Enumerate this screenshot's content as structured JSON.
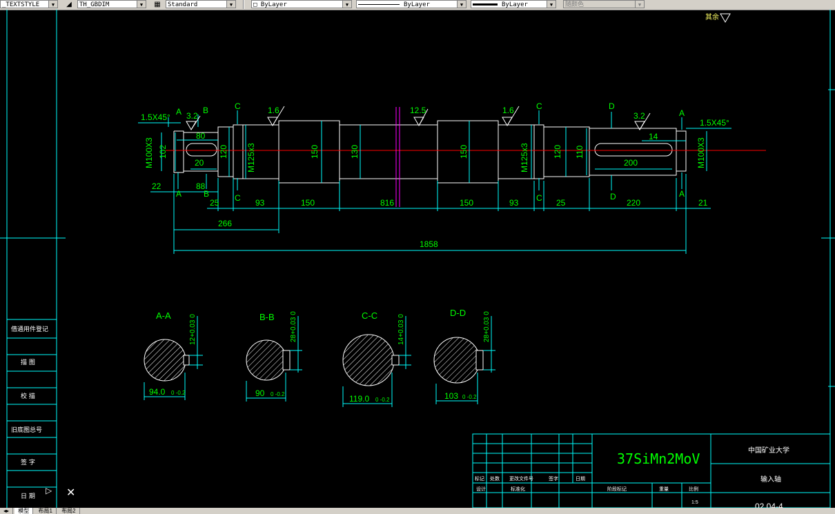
{
  "toolbar": {
    "text_style": "_TEXTSTYLE",
    "dim_style": "TH_GBDIM",
    "table_style": "Standard",
    "layer": "ByLayer",
    "linetype": "ByLayer",
    "lineweight": "ByLayer",
    "plot_style": "随颜色"
  },
  "tabs": [
    "模型",
    "布局1",
    "布局2"
  ],
  "drawing": {
    "roughness_other": "其余",
    "roughness": [
      "1.6",
      "3.2",
      "12.5",
      "1.6",
      "3.2"
    ],
    "chamfer_left": "1.5X45°",
    "chamfer_right": "1.5X45°",
    "section_marks": [
      "A",
      "B",
      "C",
      "C",
      "D",
      "A",
      "A",
      "B",
      "C",
      "C",
      "D",
      "A"
    ],
    "diameters": [
      "M100X3",
      "102",
      "120",
      "M125x3",
      "150",
      "130",
      "150",
      "M125x3",
      "120",
      "110",
      "M100X3"
    ],
    "keyway_left": [
      "80",
      "20",
      "88"
    ],
    "keyway_right": [
      "14",
      "200"
    ],
    "dims_bottom": [
      "22",
      "25",
      "93",
      "150",
      "816",
      "150",
      "93",
      "25",
      "220",
      "21"
    ],
    "dim_266": "266",
    "dim_total": "1858",
    "sections": [
      {
        "title": "A-A",
        "tol": "12+0.03 0",
        "dia": "94.0",
        "dia_tol": "0 -0.2"
      },
      {
        "title": "B-B",
        "tol": "28+0.03 0",
        "dia": "90",
        "dia_tol": "0 -0.2"
      },
      {
        "title": "C-C",
        "tol": "14+0.03 0",
        "dia": "119.0",
        "dia_tol": "0 -0.2"
      },
      {
        "title": "D-D",
        "tol": "28+0.03 0",
        "dia": "103",
        "dia_tol": "0 -0.2"
      }
    ]
  },
  "title_block": {
    "material": "37SiMn2MoV",
    "school": "中国矿业大学",
    "part_name": "输入轴",
    "drawing_no": "02.04-4",
    "scale": "1:5",
    "hdr_labels": [
      "标记",
      "处数",
      "更改文件号",
      "签字",
      "日期"
    ],
    "row_labels": [
      "设计",
      "标准化",
      "阶段标记",
      "重量",
      "比例"
    ]
  },
  "left_panel": [
    "借通用件登记",
    "描 图",
    "校 描",
    "旧底图总号",
    "签 字",
    "日 期"
  ],
  "colors": {
    "drawing": "#00ff00",
    "frame": "#00ffff",
    "centerline": "#ff0000",
    "break": "#ff00ff",
    "text": "#ffffff"
  }
}
